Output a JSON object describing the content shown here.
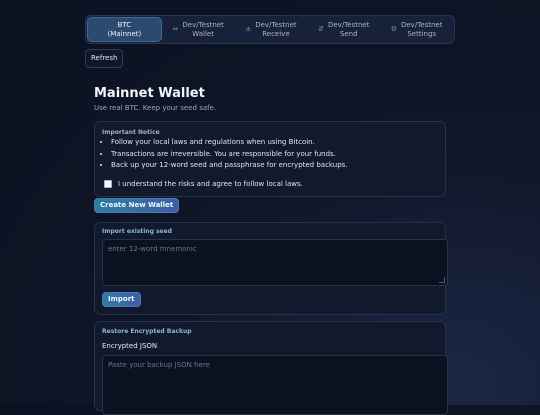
{
  "tabs": [
    {
      "label": "BTC\n(Mainnet)",
      "icon": "",
      "active": true
    },
    {
      "label": "Dev/Testnet\nWallet",
      "icon": "wallet-icon"
    },
    {
      "label": "Dev/Testnet\nReceive",
      "icon": "receive-icon"
    },
    {
      "label": "Dev/Testnet\nSend",
      "icon": "send-icon"
    },
    {
      "label": "Dev/Testnet\nSettings",
      "icon": "gear-icon"
    }
  ],
  "refresh_label": "Refresh",
  "page": {
    "title": "Mainnet Wallet",
    "subtitle": "Use real BTC. Keep your seed safe."
  },
  "notice": {
    "title": "Important Notice",
    "items": [
      "Follow your local laws and regulations when using Bitcoin.",
      "Transactions are irreversible. You are responsible for your funds.",
      "Back up your 12-word seed and passphrase for encrypted backups."
    ],
    "agree_label": "I understand the risks and agree to follow local laws.",
    "agree_checked": false
  },
  "create_label": "Create New Wallet",
  "import": {
    "title": "Import existing seed",
    "placeholder": "enter 12-word mnemonic",
    "button_label": "Import"
  },
  "restore": {
    "title": "Restore Encrypted Backup",
    "field_label": "Encrypted JSON",
    "placeholder": "Paste your backup JSON here"
  }
}
